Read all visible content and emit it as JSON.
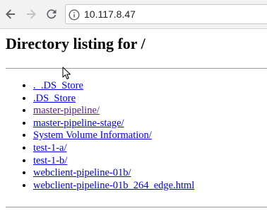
{
  "browser": {
    "back_icon": "back-arrow-icon",
    "forward_icon": "forward-arrow-icon",
    "reload_icon": "reload-icon",
    "info_icon": "info-icon",
    "address": "10.117.8.47"
  },
  "page": {
    "title": "Directory listing for /",
    "entries": [
      "._.DS_Store",
      ".DS_Store",
      "master-pipeline/",
      "master-pipeline-stage/",
      "System Volume Information/",
      "test-1-a/",
      "test-1-b/",
      "webclient-pipeline-01b/",
      "webclient-pipeline-01b_264_edge.html"
    ]
  },
  "colors": {
    "link": "#0000ee",
    "visited_link": "#551a8b",
    "toolbar_bg": "#f2f2f2"
  }
}
